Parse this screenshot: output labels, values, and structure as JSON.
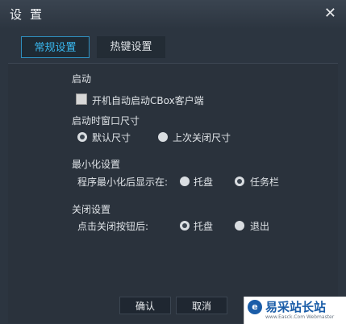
{
  "window": {
    "title": "设置",
    "close_glyph": "✕"
  },
  "tabs": [
    {
      "label": "常规设置",
      "active": true
    },
    {
      "label": "热键设置",
      "active": false
    }
  ],
  "startup": {
    "heading": "启动",
    "autostart_label": "开机自动启动CBox客户端",
    "autostart_checked": false
  },
  "window_size": {
    "heading": "启动时窗口尺寸",
    "options": [
      {
        "label": "默认尺寸",
        "selected": true
      },
      {
        "label": "上次关闭尺寸",
        "selected": false
      }
    ]
  },
  "minimize": {
    "heading": "最小化设置",
    "prompt": "程序最小化后显示在:",
    "options": [
      {
        "label": "托盘",
        "selected": false
      },
      {
        "label": "任务栏",
        "selected": true
      }
    ]
  },
  "close_settings": {
    "heading": "关闭设置",
    "prompt": "点击关闭按钮后:",
    "options": [
      {
        "label": "托盘",
        "selected": true
      },
      {
        "label": "退出",
        "selected": false
      }
    ]
  },
  "footer": {
    "confirm": "确认",
    "cancel": "取消"
  },
  "watermark": {
    "logo": "e",
    "name": "易采站长站",
    "sub": "www.Easck.Com Webmaster"
  }
}
